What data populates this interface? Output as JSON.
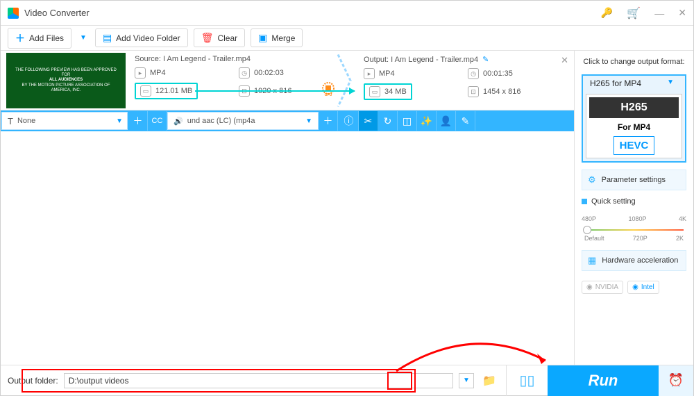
{
  "window": {
    "title": "Video Converter"
  },
  "toolbar": {
    "add_files": "Add Files",
    "add_folder": "Add Video Folder",
    "clear": "Clear",
    "merge": "Merge"
  },
  "item": {
    "source": {
      "label": "Source:",
      "name": "I Am Legend - Trailer.mp4",
      "format": "MP4",
      "duration": "00:02:03",
      "size": "121.01 MB",
      "resolution": "1920 x 816"
    },
    "output": {
      "label": "Output:",
      "name": "I Am Legend - Trailer.mp4",
      "format": "MP4",
      "duration": "00:01:35",
      "size": "34 MB",
      "resolution": "1454 x 816"
    },
    "gpu_badge": "GPU"
  },
  "tools": {
    "subtitle": "None",
    "audio": "und aac (LC) (mp4a"
  },
  "side": {
    "hint": "Click to change output format:",
    "format_title": "H265 for MP4",
    "h265": "H265",
    "for_mp4": "For MP4",
    "hevc": "HEVC",
    "parameter": "Parameter settings",
    "quick": "Quick setting",
    "hardware": "Hardware acceleration",
    "nvidia": "NVIDIA",
    "intel": "Intel",
    "q_480": "480P",
    "q_1080": "1080P",
    "q_4k": "4K",
    "q_default": "Default",
    "q_720": "720P",
    "q_2k": "2K"
  },
  "bottom": {
    "label": "Output folder:",
    "path": "D:\\output videos",
    "run": "Run"
  }
}
